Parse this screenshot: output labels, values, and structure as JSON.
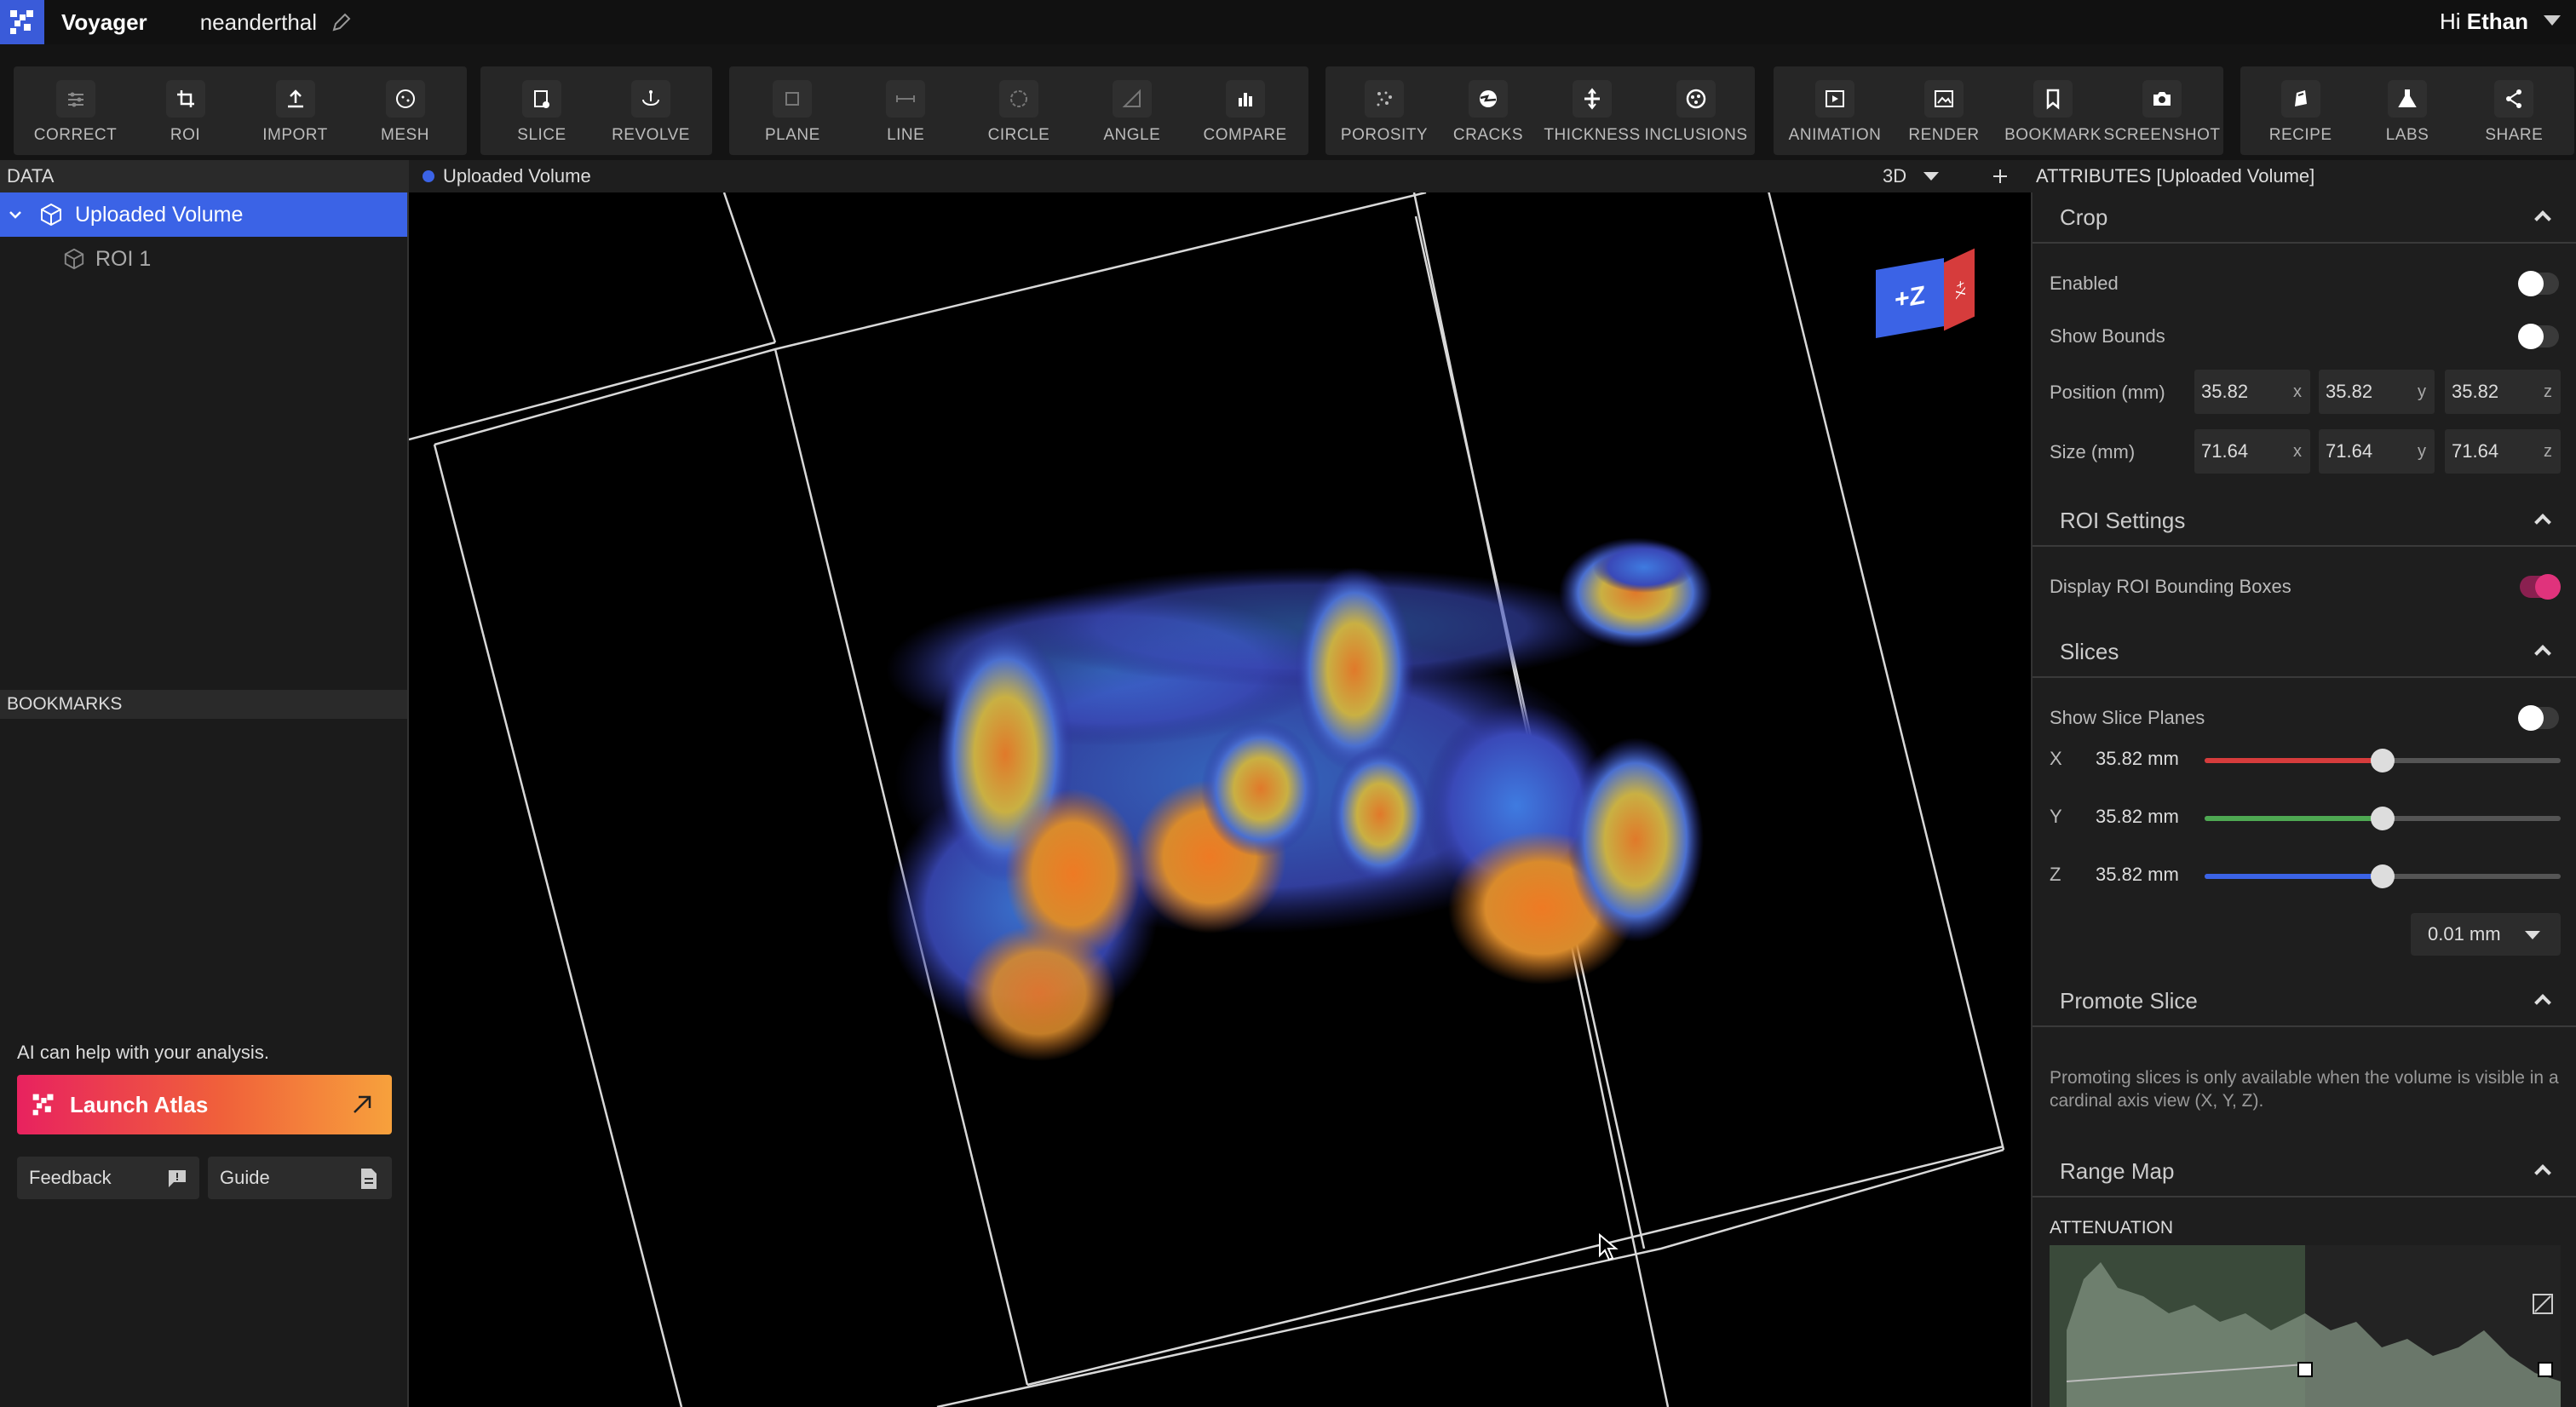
{
  "app": {
    "name": "Voyager",
    "project": "neanderthal"
  },
  "user": {
    "greeting": "Hi",
    "name": "Ethan"
  },
  "toolbar": {
    "groups": [
      [
        {
          "label": "CORRECT",
          "icon": "sliders-icon"
        },
        {
          "label": "ROI",
          "icon": "crop-icon"
        },
        {
          "label": "IMPORT",
          "icon": "upload-icon"
        },
        {
          "label": "MESH",
          "icon": "mesh-icon"
        }
      ],
      [
        {
          "label": "SLICE",
          "icon": "slice-icon"
        },
        {
          "label": "REVOLVE",
          "icon": "revolve-icon"
        }
      ],
      [
        {
          "label": "PLANE",
          "icon": "plane-icon"
        },
        {
          "label": "LINE",
          "icon": "line-icon"
        },
        {
          "label": "CIRCLE",
          "icon": "circle-icon"
        },
        {
          "label": "ANGLE",
          "icon": "angle-icon"
        },
        {
          "label": "COMPARE",
          "icon": "bar-chart-icon"
        }
      ],
      [
        {
          "label": "POROSITY",
          "icon": "porosity-icon"
        },
        {
          "label": "CRACKS",
          "icon": "cracks-icon"
        },
        {
          "label": "THICKNESS",
          "icon": "thickness-icon"
        },
        {
          "label": "INCLUSIONS",
          "icon": "inclusions-icon"
        }
      ],
      [
        {
          "label": "ANIMATION",
          "icon": "play-icon"
        },
        {
          "label": "RENDER",
          "icon": "image-icon"
        },
        {
          "label": "BOOKMARK",
          "icon": "bookmark-icon"
        },
        {
          "label": "SCREENSHOT",
          "icon": "camera-icon"
        }
      ],
      [
        {
          "label": "RECIPE",
          "icon": "recipe-icon"
        },
        {
          "label": "LABS",
          "icon": "flask-icon"
        },
        {
          "label": "SHARE",
          "icon": "share-icon"
        }
      ]
    ]
  },
  "left": {
    "data_header": "DATA",
    "tree": [
      {
        "label": "Uploaded Volume",
        "selected": true
      },
      {
        "label": "ROI 1",
        "selected": false
      }
    ],
    "bookmarks_header": "BOOKMARKS",
    "ai_text": "AI can help with your analysis.",
    "launch_label": "Launch Atlas",
    "feedback_label": "Feedback",
    "guide_label": "Guide"
  },
  "viewport": {
    "title": "Uploaded Volume",
    "mode": "3D",
    "cube_label": "+Z",
    "cube_side_label": "+X"
  },
  "attributes": {
    "header": "ATTRIBUTES [Uploaded Volume]",
    "crop": {
      "title": "Crop",
      "enabled_label": "Enabled",
      "show_bounds_label": "Show Bounds",
      "position_label": "Position (mm)",
      "position": {
        "x": "35.82",
        "y": "35.82",
        "z": "35.82"
      },
      "size_label": "Size (mm)",
      "size": {
        "x": "71.64",
        "y": "71.64",
        "z": "71.64"
      }
    },
    "roi_settings": {
      "title": "ROI Settings",
      "display_label": "Display ROI Bounding Boxes",
      "display_on": true
    },
    "slices": {
      "title": "Slices",
      "show_label": "Show Slice Planes",
      "axes": [
        {
          "axis": "X",
          "value": "35.82 mm",
          "fraction": 0.5,
          "color": "#d63c3c"
        },
        {
          "axis": "Y",
          "value": "35.82 mm",
          "fraction": 0.5,
          "color": "#4ea852"
        },
        {
          "axis": "Z",
          "value": "35.82 mm",
          "fraction": 0.5,
          "color": "#3b63e6"
        }
      ],
      "step": "0.01 mm"
    },
    "promote": {
      "title": "Promote Slice",
      "note": "Promoting slices is only available when the volume is visible in a cardinal axis view (X, Y, Z)."
    },
    "range_map": {
      "title": "Range Map",
      "attenuation_label": "ATTENUATION"
    }
  },
  "colors": {
    "accent": "#3b63e6",
    "toggle_on": "#e0337c"
  }
}
